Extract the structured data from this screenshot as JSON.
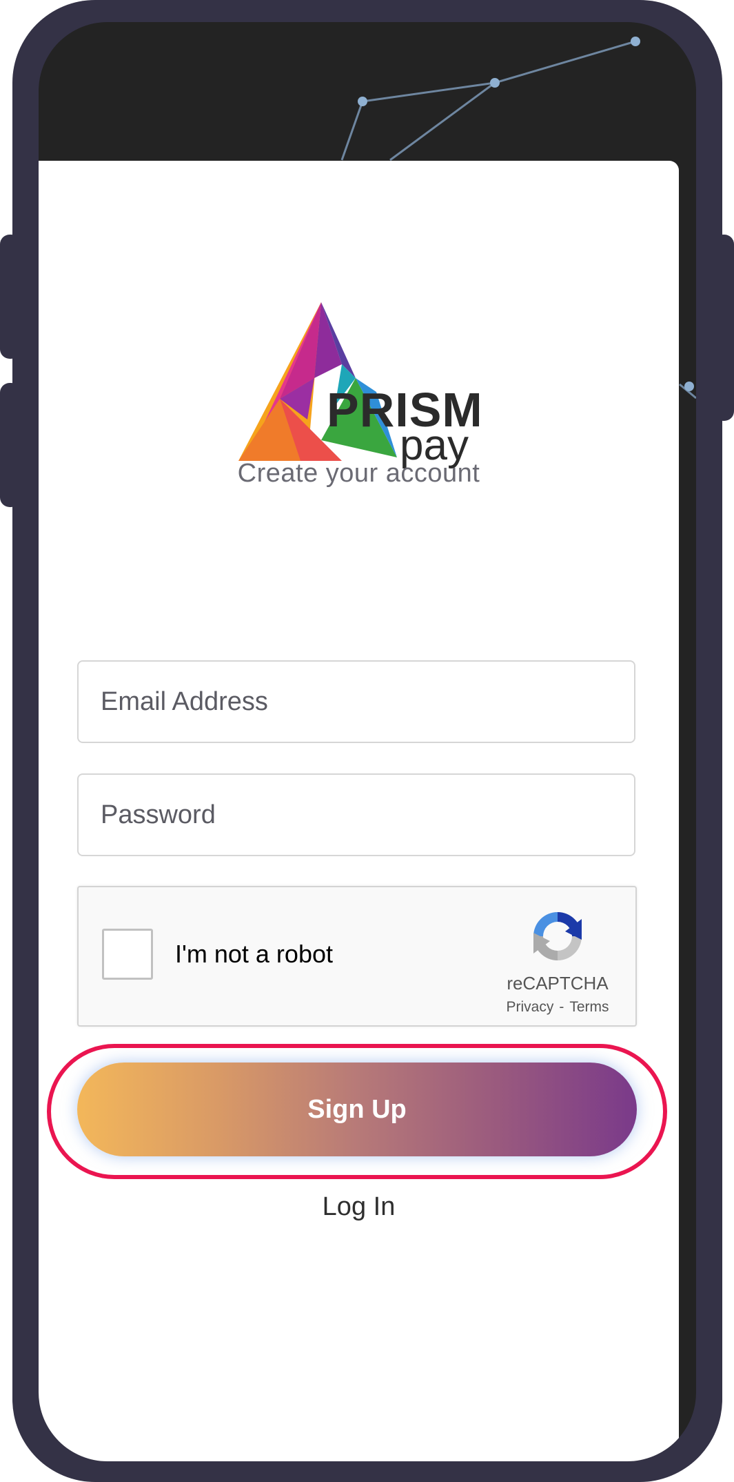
{
  "brand": {
    "name_main": "PRISM",
    "name_sub": "pay",
    "subtitle": "Create your account"
  },
  "form": {
    "email_placeholder": "Email Address",
    "email_value": "",
    "password_placeholder": "Password",
    "password_value": ""
  },
  "captcha": {
    "label": "I'm not a robot",
    "brand": "reCAPTCHA",
    "privacy": "Privacy",
    "separator": "-",
    "terms": "Terms",
    "checked": false
  },
  "actions": {
    "signup_label": "Sign Up",
    "login_label": "Log In"
  },
  "colors": {
    "frame": "#343246",
    "screen_bg": "#232323",
    "gradient_start": "#f3b75a",
    "gradient_end": "#7a3a8a",
    "highlight": "#ea1550"
  }
}
